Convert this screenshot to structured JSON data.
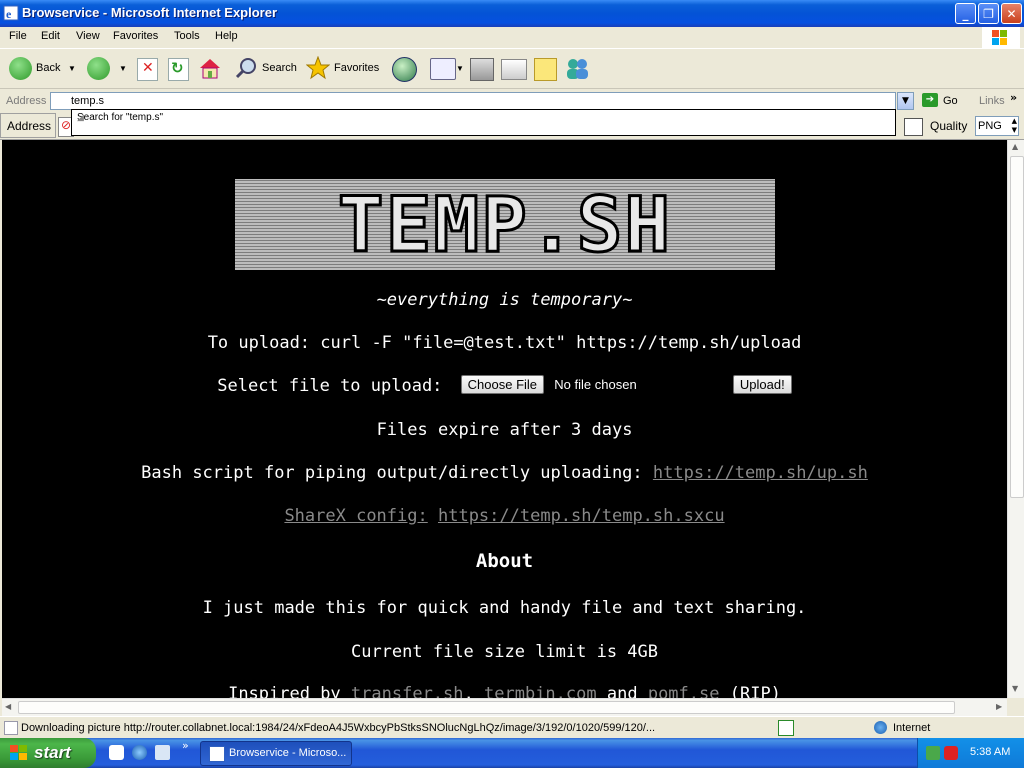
{
  "window": {
    "title": "Browservice - Microsoft Internet Explorer",
    "minimize": "_",
    "maximize": "❐",
    "close": "✕"
  },
  "menu": [
    "File",
    "Edit",
    "View",
    "Favorites",
    "Tools",
    "Help"
  ],
  "toolbar": {
    "back": "Back",
    "search": "Search",
    "favorites": "Favorites"
  },
  "address": {
    "label": "Address",
    "value": "temp.s",
    "autocomplete": "Search for \"temp.s\"",
    "go": "Go",
    "links": "Links"
  },
  "row2": {
    "address_label": "Address",
    "quality_label": "Quality",
    "quality_value": "PNG"
  },
  "page": {
    "tagline": "~everything is temporary~",
    "upload_cmd": "To upload: curl -F \"file=@test.txt\" https://temp.sh/upload",
    "select_label": "Select file to upload:",
    "choose_file": "Choose File",
    "no_file": "No file chosen",
    "upload_button": "Upload!",
    "expire": "Files expire after 3 days",
    "bash_label": "Bash script for piping output/directly uploading:",
    "bash_link": "https://temp.sh/up.sh",
    "sharex_label": "ShareX config:",
    "sharex_link": "https://temp.sh/temp.sh.sxcu",
    "about_heading": "About",
    "about_text": "I just made this for quick and handy file and text sharing.",
    "size_limit": "Current file size limit is 4GB",
    "inspired_prefix": "Inspired by",
    "inspired_link1": "transfer.sh",
    "inspired_link2": "termbin.com",
    "inspired_and": "and",
    "inspired_link3": "pomf.se",
    "inspired_suffix": "(RIP)",
    "logo_text": "TEMP.SH"
  },
  "status": {
    "text": "Downloading picture http://router.collabnet.local:1984/24/xFdeoA4J5WxbcyPbStksSNOlucNgLhQz/image/3/192/0/1020/599/120/...",
    "zone": "Internet"
  },
  "taskbar": {
    "start": "start",
    "item": "Browservice - Microso...",
    "clock": "5:38 AM"
  },
  "colors": {
    "titlebar": "#0453d6",
    "page_bg": "#000000",
    "link": "#8a8a8a",
    "taskbar": "#245edc",
    "start": "#3a9a38"
  }
}
